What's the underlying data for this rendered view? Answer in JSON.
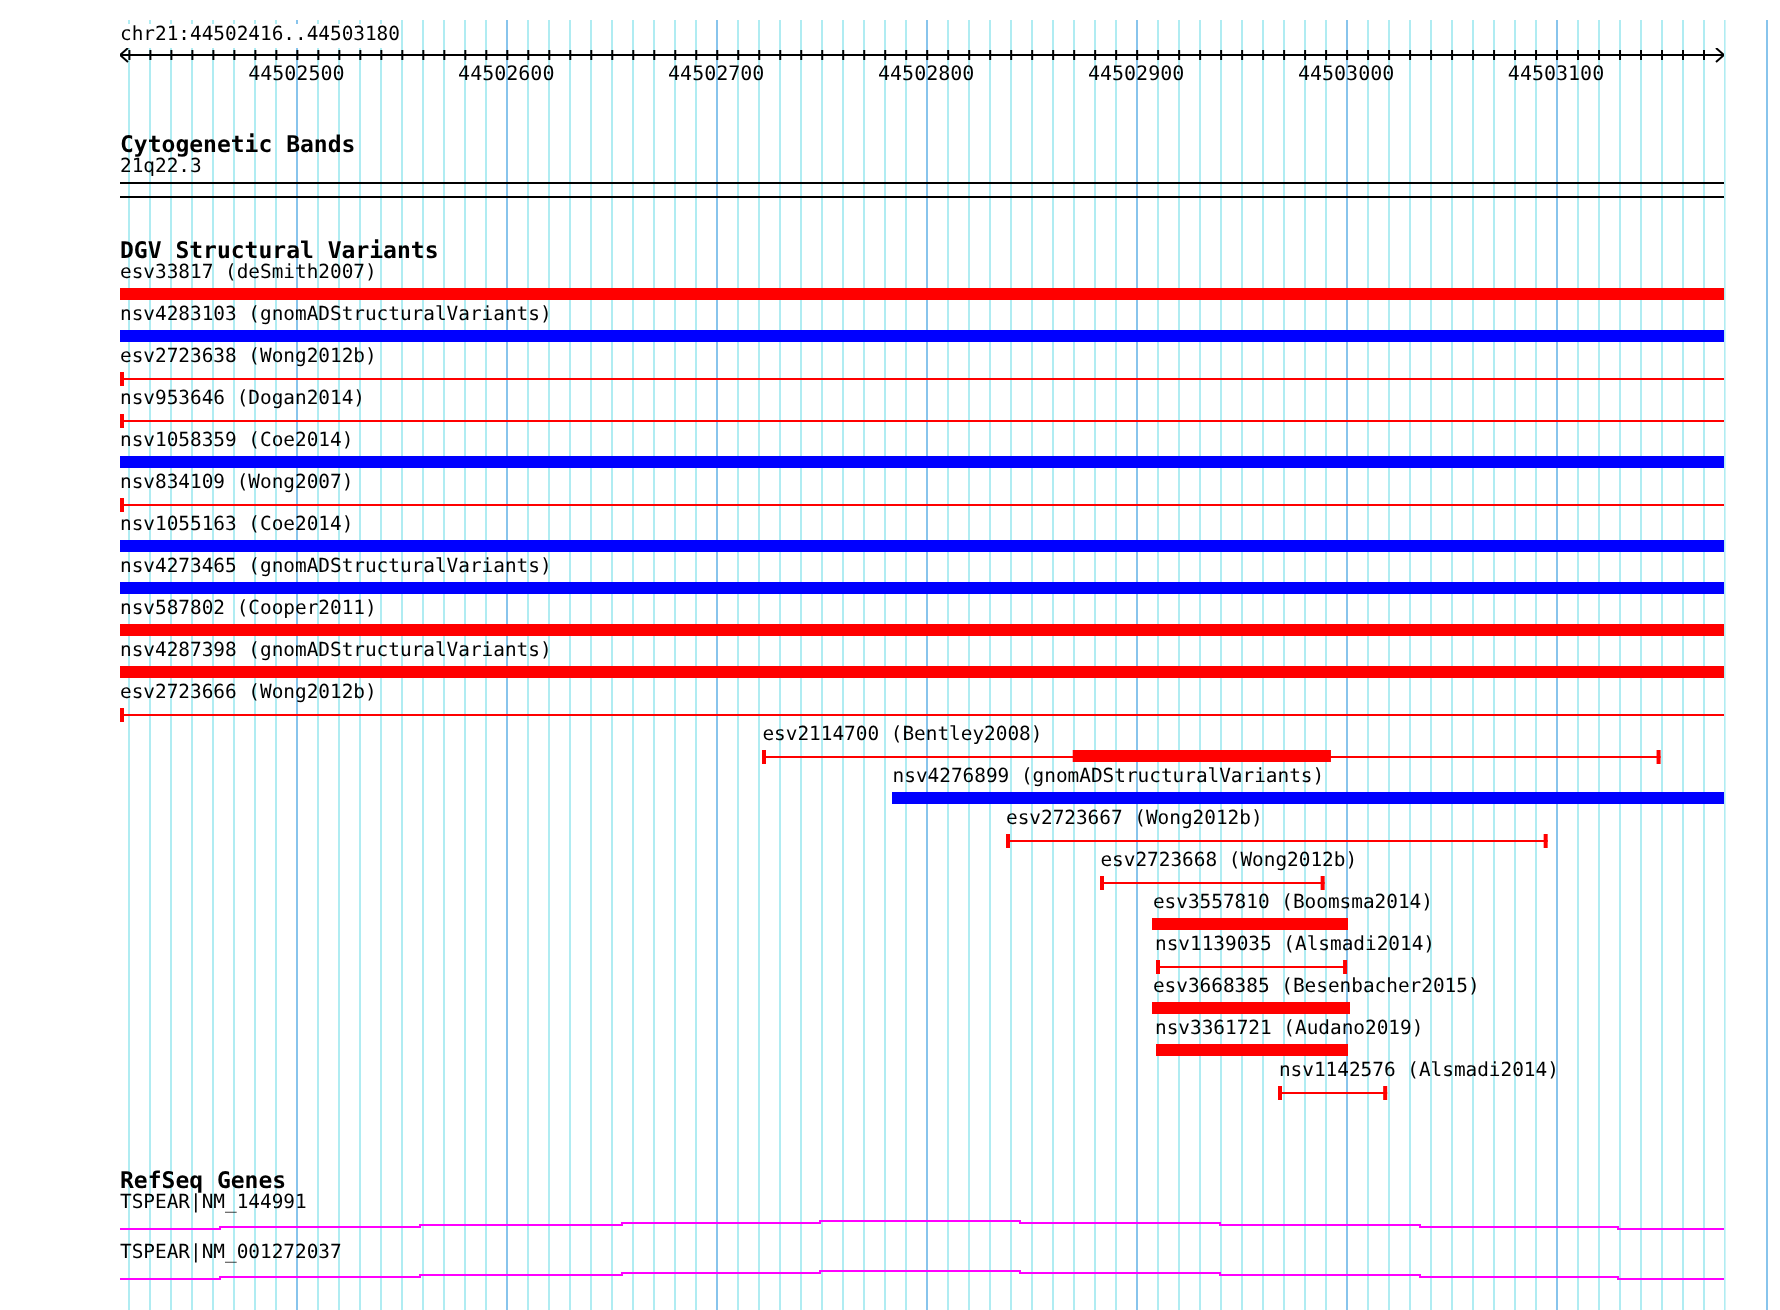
{
  "ruler": {
    "region": "chr21:44502416..44503180",
    "tick_labels": [
      "44502500",
      "44502600",
      "44502700",
      "44502800",
      "44502900",
      "44503000",
      "44503100"
    ]
  },
  "cytoband_track": {
    "title": "Cytogenetic Bands",
    "band": "21q22.3"
  },
  "dgv_track": {
    "title": "DGV Structural Variants",
    "features": [
      {
        "label": "esv33817 (deSmith2007)",
        "kind": "bar",
        "color": "#ff0000"
      },
      {
        "label": "nsv4283103 (gnomADStructuralVariants)",
        "kind": "bar",
        "color": "#0000ff"
      },
      {
        "label": "esv2723638 (Wong2012b)",
        "kind": "line",
        "color": "#ff0000"
      },
      {
        "label": "nsv953646 (Dogan2014)",
        "kind": "line",
        "color": "#ff0000"
      },
      {
        "label": "nsv1058359 (Coe2014)",
        "kind": "bar",
        "color": "#0000ff"
      },
      {
        "label": "nsv834109 (Wong2007)",
        "kind": "line",
        "color": "#ff0000"
      },
      {
        "label": "nsv1055163 (Coe2014)",
        "kind": "bar",
        "color": "#0000ff"
      },
      {
        "label": "nsv4273465 (gnomADStructuralVariants)",
        "kind": "bar",
        "color": "#0000ff"
      },
      {
        "label": "nsv587802 (Cooper2011)",
        "kind": "bar",
        "color": "#ff0000"
      },
      {
        "label": "nsv4287398 (gnomADStructuralVariants)",
        "kind": "bar",
        "color": "#ff0000"
      },
      {
        "label": "esv2723666 (Wong2012b)",
        "kind": "line",
        "color": "#ff0000"
      },
      {
        "label": "esv2114700 (Bentley2008)",
        "kind": "line",
        "color": "#ff0000"
      },
      {
        "label": "nsv4276899 (gnomADStructuralVariants)",
        "kind": "bar",
        "color": "#0000ff"
      },
      {
        "label": "esv2723667 (Wong2012b)",
        "kind": "line",
        "color": "#ff0000"
      },
      {
        "label": "esv2723668 (Wong2012b)",
        "kind": "line",
        "color": "#ff0000"
      },
      {
        "label": "esv3557810 (Boomsma2014)",
        "kind": "bar",
        "color": "#ff0000"
      },
      {
        "label": "nsv1139035 (Alsmadi2014)",
        "kind": "line",
        "color": "#ff0000"
      },
      {
        "label": "esv3668385 (Besenbacher2015)",
        "kind": "bar",
        "color": "#ff0000"
      },
      {
        "label": "nsv3361721 (Audano2019)",
        "kind": "bar",
        "color": "#ff0000"
      },
      {
        "label": "nsv1142576 (Alsmadi2014)",
        "kind": "line",
        "color": "#ff0000"
      }
    ]
  },
  "refseq_track": {
    "title": "RefSeq Genes",
    "genes": [
      {
        "label": "TSPEAR|NM_144991"
      },
      {
        "label": "TSPEAR|NM_001272037"
      }
    ]
  }
}
